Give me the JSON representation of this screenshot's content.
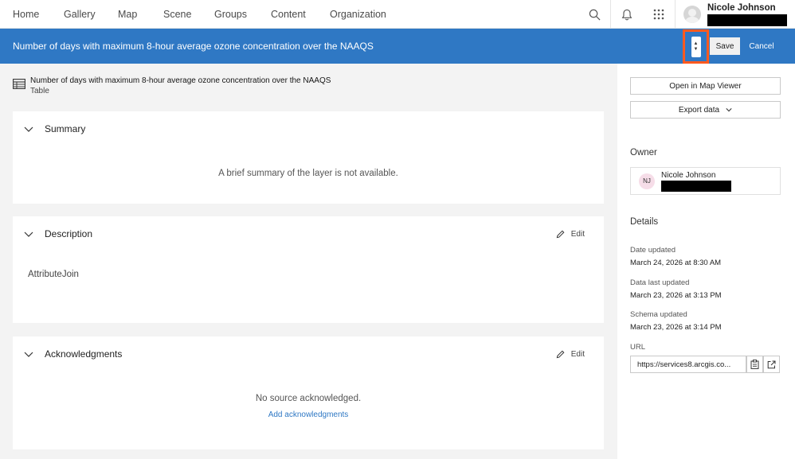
{
  "nav": {
    "items": [
      "Home",
      "Gallery",
      "Map",
      "Scene",
      "Groups",
      "Content",
      "Organization"
    ],
    "user_name": "Nicole Johnson"
  },
  "titlebar": {
    "title": "Number of days with maximum 8-hour average ozone concentration over the NAAQS",
    "save_label": "Save",
    "cancel_label": "Cancel"
  },
  "item": {
    "title": "Number of days with maximum 8-hour average ozone concentration over the NAAQS",
    "type": "Table"
  },
  "summary": {
    "title": "Summary",
    "text": "A brief summary of the layer is not available."
  },
  "description": {
    "title": "Description",
    "edit_label": "Edit",
    "text": "AttributeJoin"
  },
  "acknowledgments": {
    "title": "Acknowledgments",
    "edit_label": "Edit",
    "text": "No source acknowledged.",
    "add_label": "Add acknowledgments"
  },
  "sidebar": {
    "open_map_viewer": "Open in Map Viewer",
    "export_data": "Export data",
    "owner_heading": "Owner",
    "owner_initials": "NJ",
    "owner_name": "Nicole Johnson",
    "details_heading": "Details",
    "date_updated_label": "Date updated",
    "date_updated_value": "March 24, 2026 at 8:30 AM",
    "data_last_updated_label": "Data last updated",
    "data_last_updated_value": "March 23, 2026 at 3:13 PM",
    "schema_updated_label": "Schema updated",
    "schema_updated_value": "March 23, 2026 at 3:14 PM",
    "url_label": "URL",
    "url_value": "https://services8.arcgis.co..."
  },
  "colors": {
    "accent": "#2f78c4",
    "highlight": "#ff5a1f"
  }
}
